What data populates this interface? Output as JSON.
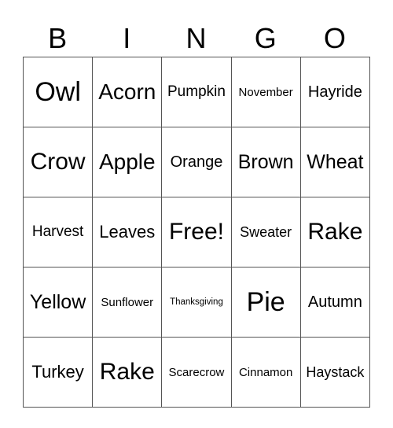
{
  "header": [
    "B",
    "I",
    "N",
    "G",
    "O"
  ],
  "rows": [
    [
      "Owl",
      "Acorn",
      "Pumpkin",
      "November",
      "Hayride"
    ],
    [
      "Crow",
      "Apple",
      "Orange",
      "Brown",
      "Wheat"
    ],
    [
      "Harvest",
      "Leaves",
      "Free!",
      "Sweater",
      "Rake"
    ],
    [
      "Yellow",
      "Sunflower",
      "Thanksgiving",
      "Pie",
      "Autumn"
    ],
    [
      "Turkey",
      "Rake",
      "Scarecrow",
      "Cinnamon",
      "Haystack"
    ]
  ]
}
